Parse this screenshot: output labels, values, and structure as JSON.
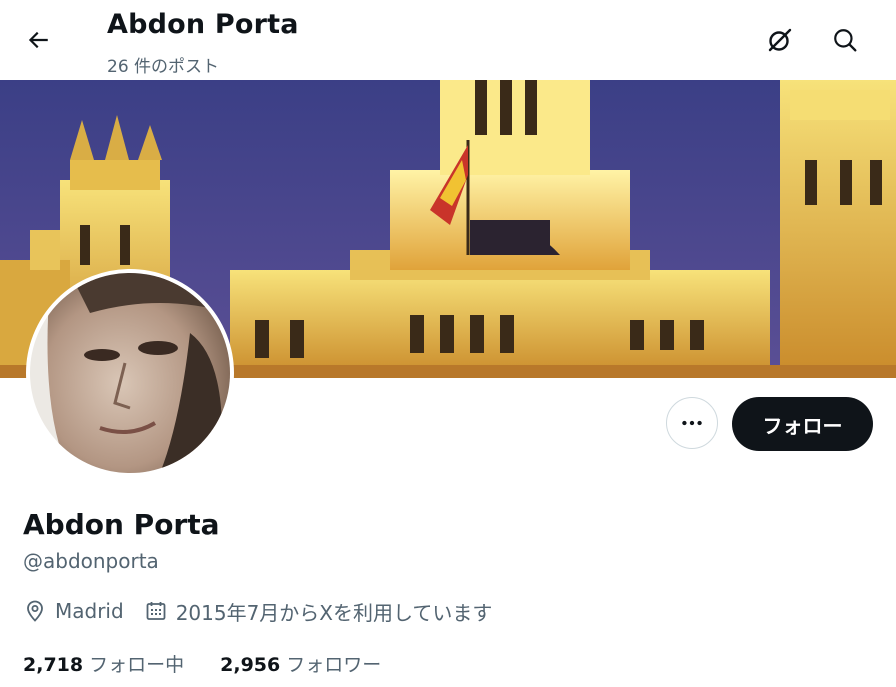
{
  "header": {
    "title": "Abdon Porta",
    "post_count": "26 件のポスト",
    "back_icon": "arrow-left-icon",
    "grok_icon": "grok-icon",
    "search_icon": "search-icon"
  },
  "profile": {
    "name": "Abdon Porta",
    "handle": "@abdonporta",
    "location": "Madrid",
    "joined": "2015年7月からXを利用しています",
    "location_icon": "location-pin-icon",
    "calendar_icon": "calendar-icon"
  },
  "actions": {
    "more_icon": "more-dots-icon",
    "follow_label": "フォロー"
  },
  "stats": {
    "following_count": "2,718",
    "following_label": "フォロー中",
    "followers_count": "2,956",
    "followers_label": "フォロワー"
  },
  "colors": {
    "text_primary": "#0f1419",
    "text_secondary": "#536471",
    "button_dark": "#0f1419",
    "border": "#cfd9de"
  }
}
